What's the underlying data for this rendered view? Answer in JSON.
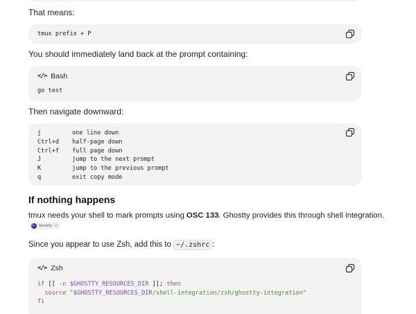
{
  "block1": {
    "lead": "That means:",
    "code": "tmux prefix + P"
  },
  "block2": {
    "lead": "You should immediately land back at the prompt containing:",
    "language": "Bash",
    "code": "go test"
  },
  "block3": {
    "lead": "Then navigate downward:",
    "rows": [
      {
        "key": "j",
        "desc": "one line down"
      },
      {
        "key": "Ctrl+d",
        "desc": "half-page down"
      },
      {
        "key": "Ctrl+f",
        "desc": "full page down"
      },
      {
        "key": "J",
        "desc": "jump to the next prompt"
      },
      {
        "key": "K",
        "desc": "jump to the previous prompt"
      },
      {
        "key": "q",
        "desc": "exit copy mode"
      }
    ]
  },
  "section": {
    "heading": "If nothing happens",
    "text_before": "tmux needs your shell to mark prompts using ",
    "bold": "OSC 133",
    "text_after": ". Ghostty provides this through shell integration.",
    "source_name": "Ghostty",
    "source_count": "+1"
  },
  "block4": {
    "lead_before": "Since you appear to use Zsh, add this to ",
    "lead_code": "~/.zshrc",
    "lead_after": ":",
    "language": "Zsh",
    "line1": {
      "kw_if": "if",
      "bracket_open": " [[ ",
      "flag": "-n",
      "var": " $GHOSTTY_RESOURCES_DIR",
      "bracket_close": " ]]; ",
      "kw_then": "then"
    },
    "line2": {
      "kw_source": "source",
      "q1": " \"",
      "var": "$GHOSTTY_RESOURCES_DIR",
      "path": "/shell-integration/zsh/ghostty-integration",
      "q2": "\""
    },
    "line3": {
      "kw_fi": "fi"
    }
  },
  "colors": {
    "code_bg": "#f3f3f3",
    "keyword": "#b24a6e",
    "variable": "#7b4bbf",
    "string": "#4d8a3a"
  }
}
